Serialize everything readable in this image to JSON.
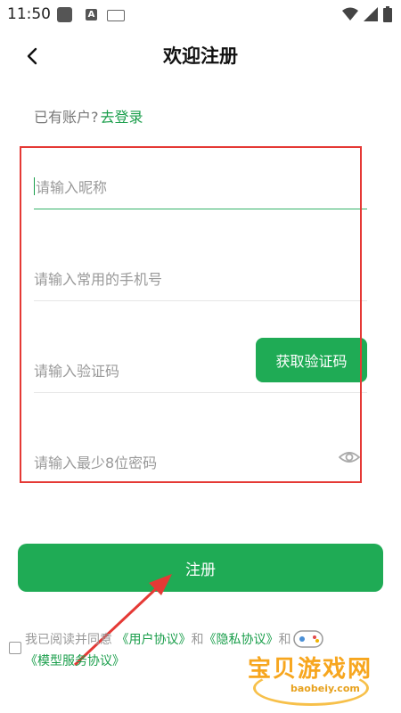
{
  "status_bar": {
    "time": "11:50",
    "keyboard_label": "A"
  },
  "header": {
    "title": "欢迎注册"
  },
  "account": {
    "prompt": "已有账户?",
    "login_link": "去登录"
  },
  "form": {
    "nickname_placeholder": "请输入昵称",
    "phone_placeholder": "请输入常用的手机号",
    "code_placeholder": "请输入验证码",
    "code_button": "获取验证码",
    "password_placeholder": "请输入最少8位密码"
  },
  "register_button": "注册",
  "agreement": {
    "text": "我已阅读并同意",
    "user_agreement": "《用户协议》",
    "and": "和",
    "privacy_agreement": "《隐私协议》",
    "and2": "和",
    "model_service": "《模型服务协议》"
  },
  "watermark": {
    "name": "宝贝游戏网",
    "url": "baobeiy.com"
  },
  "colors": {
    "accent": "#1fab55",
    "highlight": "#e53935"
  }
}
